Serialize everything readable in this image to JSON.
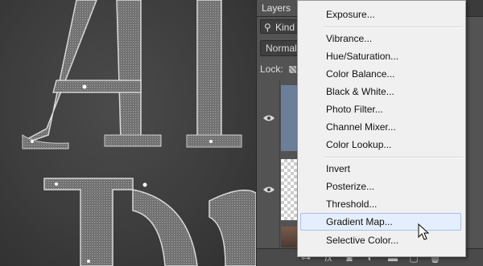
{
  "layers_panel": {
    "tab_label": "Layers",
    "filter_label": "Kind",
    "blend_mode": "Normal",
    "lock_label": "Lock:",
    "footer_icons": [
      "link-icon",
      "fx-icon",
      "mask-icon",
      "adjustment-icon",
      "folder-icon",
      "new-layer-icon",
      "trash-icon"
    ],
    "footer_glyphs": {
      "link": "⊶",
      "fx": "fx",
      "mask": "◙",
      "adjust": "◐",
      "folder": "▬",
      "new": "▢",
      "trash": "🗑"
    }
  },
  "menu": {
    "groups": [
      [
        "Exposure..."
      ],
      [
        "Vibrance...",
        "Hue/Saturation...",
        "Color Balance...",
        "Black & White...",
        "Photo Filter...",
        "Channel Mixer...",
        "Color Lookup..."
      ],
      [
        "Invert",
        "Posterize...",
        "Threshold...",
        "Gradient Map...",
        "Selective Color..."
      ]
    ],
    "items": {
      "exposure": "Exposure...",
      "vibrance": "Vibrance...",
      "hue_saturation": "Hue/Saturation...",
      "color_balance": "Color Balance...",
      "black_white": "Black & White...",
      "photo_filter": "Photo Filter...",
      "channel_mixer": "Channel Mixer...",
      "color_lookup": "Color Lookup...",
      "invert": "Invert",
      "posterize": "Posterize...",
      "threshold": "Threshold...",
      "gradient_map": "Gradient Map...",
      "selective_color": "Selective Color..."
    },
    "hovered_item": "Gradient Map..."
  },
  "colors": {
    "canvas_bg": "#3c3c3c",
    "panel_bg": "#535353",
    "menu_bg": "#f0f0f0",
    "menu_hover": "#e5eefc",
    "menu_hover_border": "#a7c1ec"
  }
}
